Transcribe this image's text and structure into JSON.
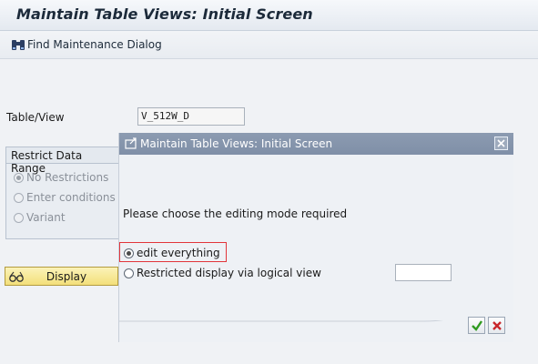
{
  "title": "Maintain Table Views: Initial Screen",
  "toolbar": {
    "find_label": "Find Maintenance Dialog"
  },
  "main": {
    "table_view_label": "Table/View",
    "table_view_value": "V_512W_D",
    "restrict": {
      "header": "Restrict Data Range",
      "options": [
        "No Restrictions",
        "Enter conditions",
        "Variant"
      ],
      "selected": "No Restrictions"
    },
    "display_label": "Display"
  },
  "dialog": {
    "title": "Maintain Table Views: Initial Screen",
    "prompt": "Please choose the editing mode required",
    "option_edit": "edit everything",
    "option_restricted": "Restricted display via logical view",
    "selected": "edit everything",
    "view_value": ""
  },
  "icons": {
    "find": "binoculars-icon",
    "display": "glasses-icon",
    "dialog": "dialog-window-icon",
    "close": "close-icon",
    "confirm": "check-icon",
    "cancel": "cancel-icon"
  },
  "colors": {
    "dialog_title_bg": "#8c9bb1",
    "highlight_outline": "#e2353a",
    "display_button": "#f3df7a",
    "confirm_green": "#2f9a1f",
    "cancel_red": "#c8262b"
  }
}
